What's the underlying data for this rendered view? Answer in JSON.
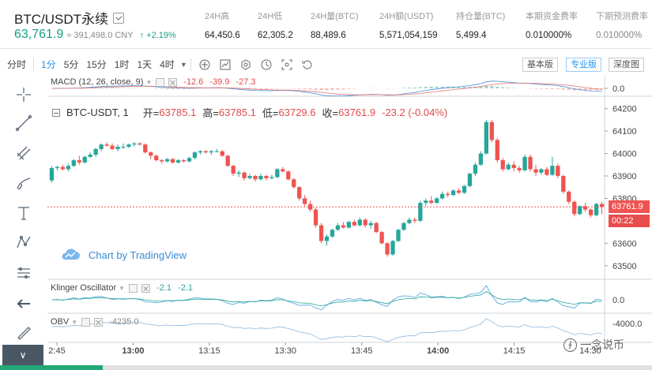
{
  "header": {
    "symbol": "BTC/USDT永续",
    "last_price": "63,761.9",
    "approx": "≈ 391,498.0 CNY",
    "change": "+2.19%",
    "stats": [
      {
        "label": "24H高",
        "value": "64,450.6",
        "muted": false
      },
      {
        "label": "24H低",
        "value": "62,305.2",
        "muted": false
      },
      {
        "label": "24H量(BTC)",
        "value": "88,489.6",
        "muted": false
      },
      {
        "label": "24H额(USDT)",
        "value": "5,571,054,159",
        "muted": false
      },
      {
        "label": "持仓量(BTC)",
        "value": "5,499.4",
        "muted": false
      },
      {
        "label": "本期资金费率",
        "value": "0.010000%",
        "muted": false
      },
      {
        "label": "下期预测费率",
        "value": "0.010000%",
        "muted": true
      }
    ]
  },
  "toolbar": {
    "intervals": [
      "分时",
      "1分",
      "5分",
      "15分",
      "1时",
      "1天",
      "4时"
    ],
    "active_interval": "1分",
    "views": [
      "基本版",
      "专业版",
      "深度图"
    ],
    "active_view": "专业版"
  },
  "macd": {
    "name": "MACD (12, 26, close, 9)",
    "v1": "-12.6",
    "v2": "-39.9",
    "v3": "-27.3",
    "axis": "0.0"
  },
  "main": {
    "title": "BTC-USDT, 1",
    "open_label": "开=",
    "open": "63785.1",
    "high_label": "高=",
    "high": "63785.1",
    "low_label": "低=",
    "low": "63729.6",
    "close_label": "收=",
    "close": "63761.9",
    "change": "-23.2 (-0.04%)",
    "current_price": "63761.9",
    "countdown": "00:22",
    "watermark": "Chart by TradingView"
  },
  "klinger": {
    "name": "Klinger Oscillator",
    "v1": "-2.1",
    "v2": "-2.1",
    "axis": "0.0"
  },
  "obv": {
    "name": "OBV",
    "v1": "-4235.0",
    "axis": "-4000.0"
  },
  "corner_watermark": "一念说币",
  "chart_data": {
    "type": "candlestick",
    "title": "BTC-USDT, 1",
    "ylim": [
      63450,
      64220
    ],
    "y_ticks": [
      64200,
      64100,
      64000,
      63900,
      63800,
      63600,
      63500
    ],
    "x_ticks": [
      "2:45",
      "13:00",
      "13:15",
      "13:30",
      "13:45",
      "14:00",
      "14:15",
      "14:30"
    ],
    "current_price": 63761.9,
    "candles": [
      [
        63880,
        63945,
        63870,
        63935
      ],
      [
        63935,
        63945,
        63925,
        63940
      ],
      [
        63940,
        63950,
        63925,
        63930
      ],
      [
        63930,
        63955,
        63920,
        63945
      ],
      [
        63945,
        63975,
        63940,
        63970
      ],
      [
        63970,
        63990,
        63950,
        63960
      ],
      [
        63960,
        63990,
        63955,
        63985
      ],
      [
        63985,
        64005,
        63980,
        63995
      ],
      [
        63995,
        64025,
        63985,
        64020
      ],
      [
        64020,
        64045,
        64010,
        64040
      ],
      [
        64040,
        64050,
        64030,
        64035
      ],
      [
        64035,
        64045,
        64015,
        64020
      ],
      [
        64020,
        64040,
        64010,
        64030
      ],
      [
        64030,
        64045,
        64020,
        64030
      ],
      [
        64030,
        64045,
        64025,
        64040
      ],
      [
        64040,
        64050,
        64030,
        64045
      ],
      [
        64045,
        64050,
        64035,
        64040
      ],
      [
        64040,
        64045,
        64000,
        64005
      ],
      [
        64005,
        64010,
        63975,
        63990
      ],
      [
        63990,
        63995,
        63965,
        63970
      ],
      [
        63970,
        63975,
        63955,
        63965
      ],
      [
        63965,
        63980,
        63960,
        63975
      ],
      [
        63975,
        63980,
        63955,
        63960
      ],
      [
        63960,
        63975,
        63955,
        63970
      ],
      [
        63970,
        63975,
        63960,
        63965
      ],
      [
        63965,
        63985,
        63960,
        63980
      ],
      [
        63980,
        64010,
        63975,
        64005
      ],
      [
        64005,
        64015,
        63995,
        64010
      ],
      [
        64010,
        64015,
        64000,
        64005
      ],
      [
        64005,
        64015,
        63995,
        64010
      ],
      [
        64010,
        64020,
        64005,
        64010
      ],
      [
        64010,
        64015,
        63985,
        63990
      ],
      [
        63990,
        63995,
        63940,
        63945
      ],
      [
        63945,
        63950,
        63900,
        63910
      ],
      [
        63910,
        63925,
        63895,
        63915
      ],
      [
        63915,
        63920,
        63880,
        63890
      ],
      [
        63890,
        63910,
        63885,
        63900
      ],
      [
        63900,
        63905,
        63875,
        63885
      ],
      [
        63885,
        63910,
        63880,
        63900
      ],
      [
        63900,
        63905,
        63880,
        63890
      ],
      [
        63890,
        63905,
        63885,
        63895
      ],
      [
        63895,
        63935,
        63890,
        63930
      ],
      [
        63930,
        63940,
        63915,
        63920
      ],
      [
        63920,
        63925,
        63880,
        63885
      ],
      [
        63885,
        63890,
        63845,
        63850
      ],
      [
        63850,
        63855,
        63790,
        63800
      ],
      [
        63800,
        63815,
        63765,
        63775
      ],
      [
        63775,
        63790,
        63740,
        63750
      ],
      [
        63750,
        63760,
        63670,
        63680
      ],
      [
        63680,
        63690,
        63600,
        63610
      ],
      [
        63610,
        63640,
        63590,
        63630
      ],
      [
        63630,
        63665,
        63625,
        63660
      ],
      [
        63660,
        63690,
        63655,
        63680
      ],
      [
        63680,
        63695,
        63665,
        63670
      ],
      [
        63670,
        63700,
        63665,
        63695
      ],
      [
        63695,
        63705,
        63675,
        63680
      ],
      [
        63680,
        63715,
        63675,
        63705
      ],
      [
        63705,
        63710,
        63670,
        63680
      ],
      [
        63680,
        63700,
        63665,
        63690
      ],
      [
        63690,
        63695,
        63645,
        63650
      ],
      [
        63650,
        63655,
        63595,
        63600
      ],
      [
        63600,
        63605,
        63540,
        63550
      ],
      [
        63550,
        63615,
        63545,
        63610
      ],
      [
        63610,
        63665,
        63605,
        63660
      ],
      [
        63660,
        63695,
        63655,
        63690
      ],
      [
        63690,
        63715,
        63685,
        63705
      ],
      [
        63705,
        63715,
        63690,
        63700
      ],
      [
        63700,
        63790,
        63695,
        63780
      ],
      [
        63780,
        63800,
        63765,
        63790
      ],
      [
        63790,
        63810,
        63775,
        63780
      ],
      [
        63780,
        63805,
        63775,
        63800
      ],
      [
        63800,
        63830,
        63795,
        63820
      ],
      [
        63820,
        63830,
        63805,
        63815
      ],
      [
        63815,
        63840,
        63810,
        63835
      ],
      [
        63835,
        63845,
        63820,
        63825
      ],
      [
        63825,
        63860,
        63820,
        63855
      ],
      [
        63855,
        63915,
        63850,
        63910
      ],
      [
        63910,
        63960,
        63900,
        63950
      ],
      [
        63950,
        64010,
        63945,
        64000
      ],
      [
        64000,
        64150,
        63995,
        64140
      ],
      [
        64140,
        64150,
        64050,
        64060
      ],
      [
        64060,
        64070,
        63960,
        63970
      ],
      [
        63970,
        63980,
        63920,
        63930
      ],
      [
        63930,
        63960,
        63925,
        63950
      ],
      [
        63950,
        63965,
        63920,
        63935
      ],
      [
        63935,
        63945,
        63915,
        63925
      ],
      [
        63925,
        63995,
        63920,
        63985
      ],
      [
        63985,
        63995,
        63920,
        63930
      ],
      [
        63930,
        63950,
        63900,
        63915
      ],
      [
        63915,
        63935,
        63905,
        63930
      ],
      [
        63930,
        63940,
        63900,
        63905
      ],
      [
        63905,
        63985,
        63900,
        63945
      ],
      [
        63945,
        63955,
        63890,
        63900
      ],
      [
        63900,
        63905,
        63820,
        63830
      ],
      [
        63830,
        63835,
        63775,
        63785
      ],
      [
        63785,
        63790,
        63720,
        63730
      ],
      [
        63730,
        63770,
        63725,
        63765
      ],
      [
        63765,
        63780,
        63740,
        63750
      ],
      [
        63750,
        63755,
        63715,
        63725
      ],
      [
        63725,
        63780,
        63720,
        63775
      ],
      [
        63775,
        63785,
        63730,
        63762
      ]
    ]
  }
}
